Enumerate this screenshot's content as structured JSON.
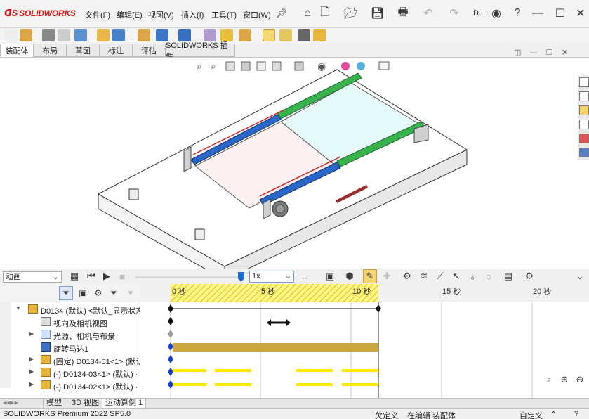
{
  "app": {
    "brand": "SOLIDWORKS",
    "user_initial": "D..."
  },
  "menu": [
    "文件(F)",
    "编辑(E)",
    "视图(V)",
    "插入(I)",
    "工具(T)",
    "窗口(W)"
  ],
  "tabs": [
    "装配体",
    "布局",
    "草图",
    "标注",
    "评估",
    "SOLIDWORKS 插件"
  ],
  "active_tab": "装配体",
  "motion": {
    "study_type": "动画",
    "speed": "1x",
    "playback_progress": 0.98
  },
  "timeline": {
    "ticks": [
      "0",
      "5",
      "10",
      "15",
      "20"
    ],
    "tick_unit": "秒"
  },
  "tree": [
    {
      "label": "D0134 (默认) <默认_显示状态",
      "expand": "▼",
      "icon": "assembly-icon"
    },
    {
      "label": "视向及相机视图",
      "expand": "",
      "icon": "camera-view-icon"
    },
    {
      "label": "光源、相机与布景",
      "expand": "▶",
      "icon": "lights-icon"
    },
    {
      "label": "旋转马达1",
      "expand": "",
      "icon": "rotary-motor-icon"
    },
    {
      "label": "(固定) D0134-01<1> (默认",
      "expand": "▶",
      "icon": "part-icon"
    },
    {
      "label": "(-) D0134-03<1> (默认) ·",
      "expand": "▶",
      "icon": "part-icon"
    },
    {
      "label": "(-) D0134-02<1> (默认) ·",
      "expand": "▶",
      "icon": "part-icon"
    }
  ],
  "bottom_tabs": [
    "模型",
    "3D 视图",
    "运动算例 1"
  ],
  "active_bottom_tab": "运动算例 1",
  "status": {
    "product": "SOLIDWORKS Premium 2022 SP5.0",
    "defined": "欠定义",
    "editing": "在编辑 装配体",
    "units": "自定义"
  },
  "colors": {
    "brand_red": "#d11f1f",
    "timeline_yellow": "#ffe600",
    "motor_bar": "#c9a640",
    "accent_blue": "#1f6fd3"
  }
}
